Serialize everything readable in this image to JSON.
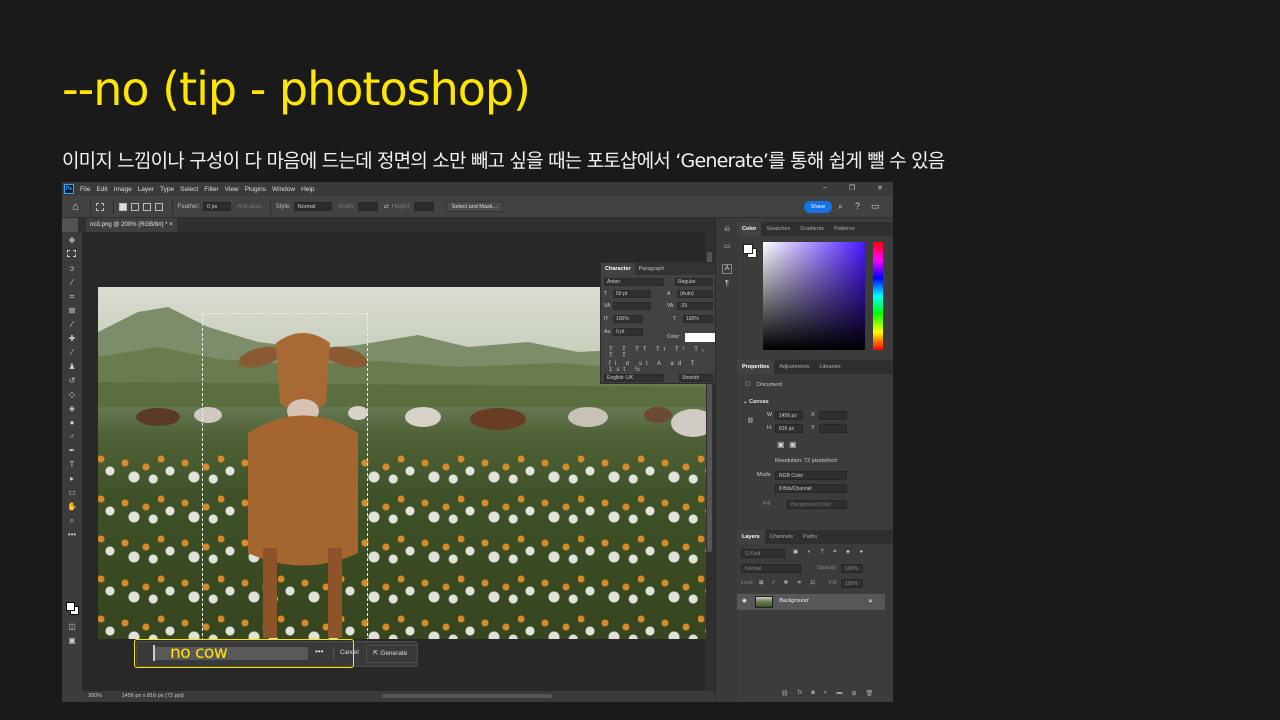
{
  "slide": {
    "title": "--no (tip - photoshop)",
    "subtitle": "이미지 느낌이나 구성이 다 마음에 드는데 정면의 소만 빼고 싶을 때는 포토샵에서 ‘Generate’를 통해 쉽게 뺄 수 있음"
  },
  "photoshop": {
    "menu": [
      "File",
      "Edit",
      "Image",
      "Layer",
      "Type",
      "Select",
      "Filter",
      "View",
      "Plugins",
      "Window",
      "Help"
    ],
    "logo": "Ps",
    "window_controls": [
      "–",
      "❐",
      "✕"
    ],
    "options": {
      "feather_label": "Feather:",
      "feather_value": "0 px",
      "antialias_label": "Anti-alias",
      "style_label": "Style:",
      "style_value": "Normal",
      "width_label": "Width:",
      "height_label": "Height:",
      "select_mask_label": "Select and Mask...",
      "share_label": "Share"
    },
    "doc_tab": "no3.png @ 200% (RGB/8#) *  ×",
    "generate_bar": {
      "prompt": "no cow",
      "more_label": "•••",
      "cancel_label": "Cancel",
      "generate_label": "Generate"
    },
    "status": {
      "zoom": "200%",
      "doc_info": "1456 px x 816 px (72 ppi)"
    },
    "character_panel": {
      "tabs": [
        "Character",
        "Paragraph"
      ],
      "font": "Anton",
      "style": "Regular",
      "size": "50 pt",
      "leading": "(Auto)",
      "tracking": "-25",
      "vscale": "100%",
      "hscale": "100%",
      "baseline": "0 pt",
      "color_label": "Color:",
      "language": "English: UK",
      "aa": "Smooth"
    },
    "color_panel": {
      "tabs": [
        "Color",
        "Swatches",
        "Gradients",
        "Patterns"
      ]
    },
    "properties_panel": {
      "tabs": [
        "Properties",
        "Adjustments",
        "Libraries"
      ],
      "document_label": "Document",
      "canvas_label": "Canvas",
      "w_label": "W",
      "w_value": "1456 px",
      "h_label": "H",
      "h_value": "816 px",
      "x_label": "X",
      "y_label": "Y",
      "resolution": "Resolution: 72 pixels/inch",
      "mode_label": "Mode",
      "mode_value": "RGB Color",
      "depth_value": "8 Bits/Channel",
      "fill_label": "Fill",
      "fill_value": "Background Color"
    },
    "layers_panel": {
      "tabs": [
        "Layers",
        "Channels",
        "Paths"
      ],
      "kind_label": "Q Kind",
      "blend_value": "Normal",
      "opacity_label": "Opacity:",
      "opacity_value": "100%",
      "lock_label": "Lock:",
      "fill_label": "Fill:",
      "fill_value": "100%",
      "layer_name": "Background"
    }
  }
}
